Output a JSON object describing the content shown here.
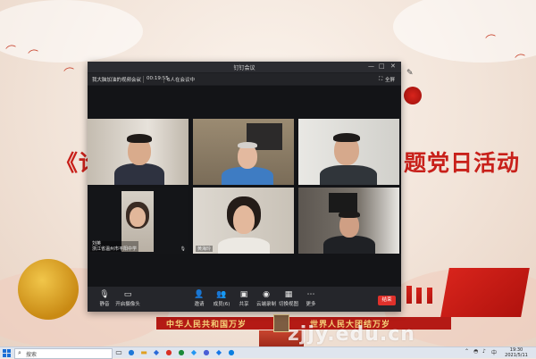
{
  "wallpaper": {
    "title_left": "《论",
    "title_right": "题党日活动",
    "banner_left": "中华人民共和国万岁",
    "banner_right": "世界人民大团结万岁",
    "watermark": "zjjy.edu.cn"
  },
  "window": {
    "title": "钉钉会议",
    "meeting_name": "我大脑加油的视频会议",
    "elapsed": "00:19:55",
    "participants": "6人在会议中",
    "top_right_label": "全屏",
    "controls": {
      "minimize": "—",
      "maximize": "□",
      "close": "✕"
    }
  },
  "video_tiles": [
    {
      "name": "",
      "bg": "#cfc9c0"
    },
    {
      "name": "",
      "bg": "#8a7d68"
    },
    {
      "name": "",
      "bg": "#d9d9d4"
    },
    {
      "name": "刘英\n浙江省温州市平阳中学",
      "bg": "#141518"
    },
    {
      "name": "黄海玲",
      "bg": "#dcd6ce"
    },
    {
      "name": "",
      "bg": "#6f6a63"
    }
  ],
  "toolbar": {
    "buttons": [
      {
        "icon": "microphone-icon",
        "glyph": "🎙",
        "label": "静音"
      },
      {
        "icon": "camera-icon",
        "glyph": "▭",
        "label": "开启摄像头"
      },
      {
        "icon": "invite-icon",
        "glyph": "👤",
        "label": "邀请"
      },
      {
        "icon": "members-icon",
        "glyph": "👥",
        "label": "成员(6)"
      },
      {
        "icon": "share-screen-icon",
        "glyph": "▣",
        "label": "共享"
      },
      {
        "icon": "record-icon",
        "glyph": "◉",
        "label": "云端录制"
      },
      {
        "icon": "layout-icon",
        "glyph": "▦",
        "label": "切换视图"
      },
      {
        "icon": "more-icon",
        "glyph": "⋯",
        "label": "更多"
      }
    ],
    "leave_label": "结束"
  },
  "taskbar": {
    "search_placeholder": "搜索",
    "time": "19:30",
    "date": "2021/5/11"
  }
}
